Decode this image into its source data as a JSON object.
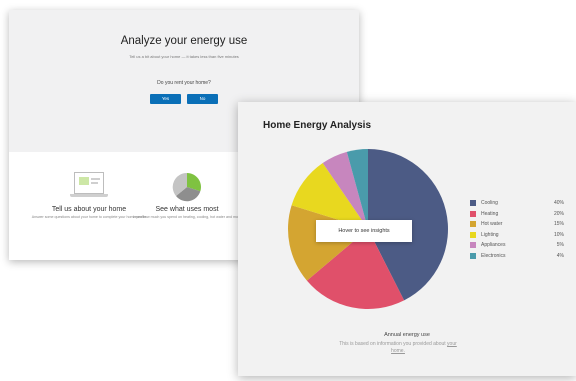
{
  "back_card": {
    "title": "Analyze your energy use",
    "subtitle": "Tell us a bit about your home — it takes less than five minutes",
    "question": "Do you rent your home?",
    "yes_label": "Yes",
    "no_label": "No",
    "features": [
      {
        "title": "Tell us about your home",
        "description": "Answer some questions about your home to complete your home profile"
      },
      {
        "title": "See what uses most",
        "description": "Learn how much you spend on heating, cooling, hot water and more"
      }
    ]
  },
  "front_card": {
    "title": "Home Energy Analysis",
    "tooltip": "Hover to see insights",
    "annual_label": "Annual energy use",
    "note_text": "This is based on information you provided about ",
    "note_link": "your home."
  },
  "chart_data": {
    "type": "pie",
    "categories": [
      "Cooling",
      "Heating",
      "Hot water",
      "Lighting",
      "Appliances",
      "Electronics"
    ],
    "values": [
      40,
      20,
      15,
      10,
      5,
      4
    ],
    "labels": [
      "40%",
      "20%",
      "15%",
      "10%",
      "5%",
      "4%"
    ],
    "colors": [
      "#4c5b85",
      "#e0506a",
      "#d4a531",
      "#e8d81f",
      "#c786be",
      "#4a9bab"
    ],
    "legend_placement": "right"
  },
  "mini_pie_colors": [
    "#7fc241",
    "#8e8e8e",
    "#c4c4c4"
  ]
}
